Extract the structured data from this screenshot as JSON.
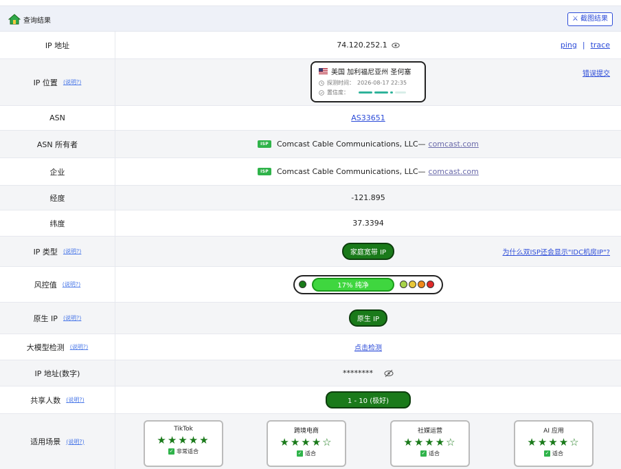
{
  "header": {
    "title": "查询结果",
    "screenshot_btn": "⚔ 截图结果",
    "home_icon": "home-icon"
  },
  "rows": {
    "ip": {
      "label": "IP 地址",
      "value": "74.120.252.1",
      "ping": "ping",
      "sep": "|",
      "trace": "trace"
    },
    "location": {
      "label": "IP 位置",
      "help": "(说明?)",
      "country": "美国 加利福尼亚州 圣何塞",
      "probe_label": "探测时间：",
      "probe_time": "2026-08-17 22:35",
      "conf_label": "置信度：",
      "report": "错误提交"
    },
    "asn": {
      "label": "ASN",
      "value": "AS33651"
    },
    "asn_owner": {
      "label": "ASN 所有者",
      "badge": "ISP",
      "name": "Comcast Cable Communications, LLC",
      "dash": "—",
      "domain": "comcast.com"
    },
    "company": {
      "label": "企业",
      "badge": "ISP",
      "name": "Comcast Cable Communications, LLC",
      "dash": "—",
      "domain": "comcast.com"
    },
    "lon": {
      "label": "经度",
      "value": "-121.895"
    },
    "lat": {
      "label": "纬度",
      "value": "37.3394"
    },
    "ip_type": {
      "label": "IP 类型",
      "help": "(说明?)",
      "value": "家庭宽带 IP",
      "right": "为什么双ISP还会显示\"IDC机房IP\"?"
    },
    "risk": {
      "label": "风控值",
      "help": "(说明?)",
      "value": "17%  纯净",
      "colors": [
        "#1a7a1a",
        "#a8d44a",
        "#e8c83a",
        "#f08a1a",
        "#e02a2a"
      ]
    },
    "native": {
      "label": "原生 IP",
      "help": "(说明?)",
      "value": "原生 IP"
    },
    "llm": {
      "label": "大模型检测",
      "help": "(说明?)",
      "value": "点击检测"
    },
    "ip_num": {
      "label": "IP 地址(数字)",
      "value": "********"
    },
    "share": {
      "label": "共享人数",
      "help": "(说明?)",
      "value": "1 - 10 (极好)"
    },
    "scenes": {
      "label": "适用场景",
      "help": "(说明?)",
      "items": [
        {
          "name": "TikTok",
          "stars": "★★★★★",
          "fit": "非常适合"
        },
        {
          "name": "跨境电商",
          "stars": "★★★★☆",
          "fit": "适合"
        },
        {
          "name": "社媒运营",
          "stars": "★★★★☆",
          "fit": "适合"
        },
        {
          "name": "AI 应用",
          "stars": "★★★★☆",
          "fit": "适合"
        }
      ]
    }
  }
}
